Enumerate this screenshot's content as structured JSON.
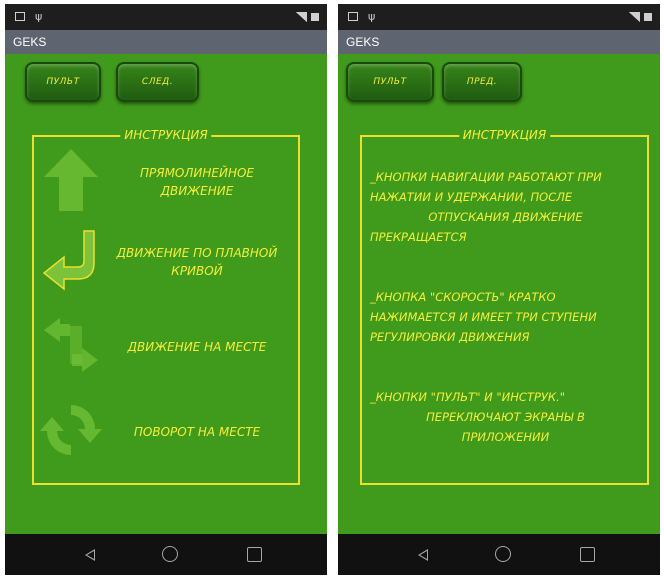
{
  "screens": [
    {
      "app_title": "GEKS",
      "buttons": [
        {
          "label": "ПУЛЬТ"
        },
        {
          "label": "СЛЕД."
        }
      ],
      "instruction_title": "ИНСТРУКЦИЯ",
      "items": [
        {
          "label": "ПРЯМОЛИНЕЙНОЕ ДВИЖЕНИЕ",
          "icon": "arrow-up-icon"
        },
        {
          "label": "ДВИЖЕНИЕ ПО ПЛАВНОЙ КРИВОЙ",
          "icon": "curved-arrow-icon"
        },
        {
          "label": "ДВИЖЕНИЕ НА МЕСТЕ",
          "icon": "opposing-arrows-icon"
        },
        {
          "label": "ПОВОРОТ НА МЕСТЕ",
          "icon": "rotate-icon"
        }
      ]
    },
    {
      "app_title": "GEKS",
      "buttons": [
        {
          "label": "ПУЛЬТ"
        },
        {
          "label": "ПРЕД."
        }
      ],
      "instruction_title": "ИНСТРУКЦИЯ",
      "paragraphs": [
        {
          "lines": [
            "_КНОПКИ НАВИГАЦИИ РАБОТАЮТ ПРИ",
            "НАЖАТИИ И УДЕРЖАНИИ, ПОСЛЕ",
            "ОТПУСКАНИЯ ДВИЖЕНИЕ",
            "ПРЕКРАЩАЕТСЯ"
          ]
        },
        {
          "lines": [
            "_КНОПКА \"СКОРОСТЬ\" КРАТКО",
            "НАЖИМАЕТСЯ И ИМЕЕТ ТРИ СТУПЕНИ",
            "РЕГУЛИРОВКИ ДВИЖЕНИЯ"
          ]
        },
        {
          "lines": [
            "_КНОПКИ \"ПУЛЬТ\" И \"ИНСТРУК.\"",
            "ПЕРЕКЛЮЧАЮТ ЭКРАНЫ В",
            "ПРИЛОЖЕНИИ"
          ]
        }
      ]
    }
  ],
  "colors": {
    "background": "#409a1b",
    "text": "#f5ef3a",
    "app_bar": "#5e6570"
  }
}
